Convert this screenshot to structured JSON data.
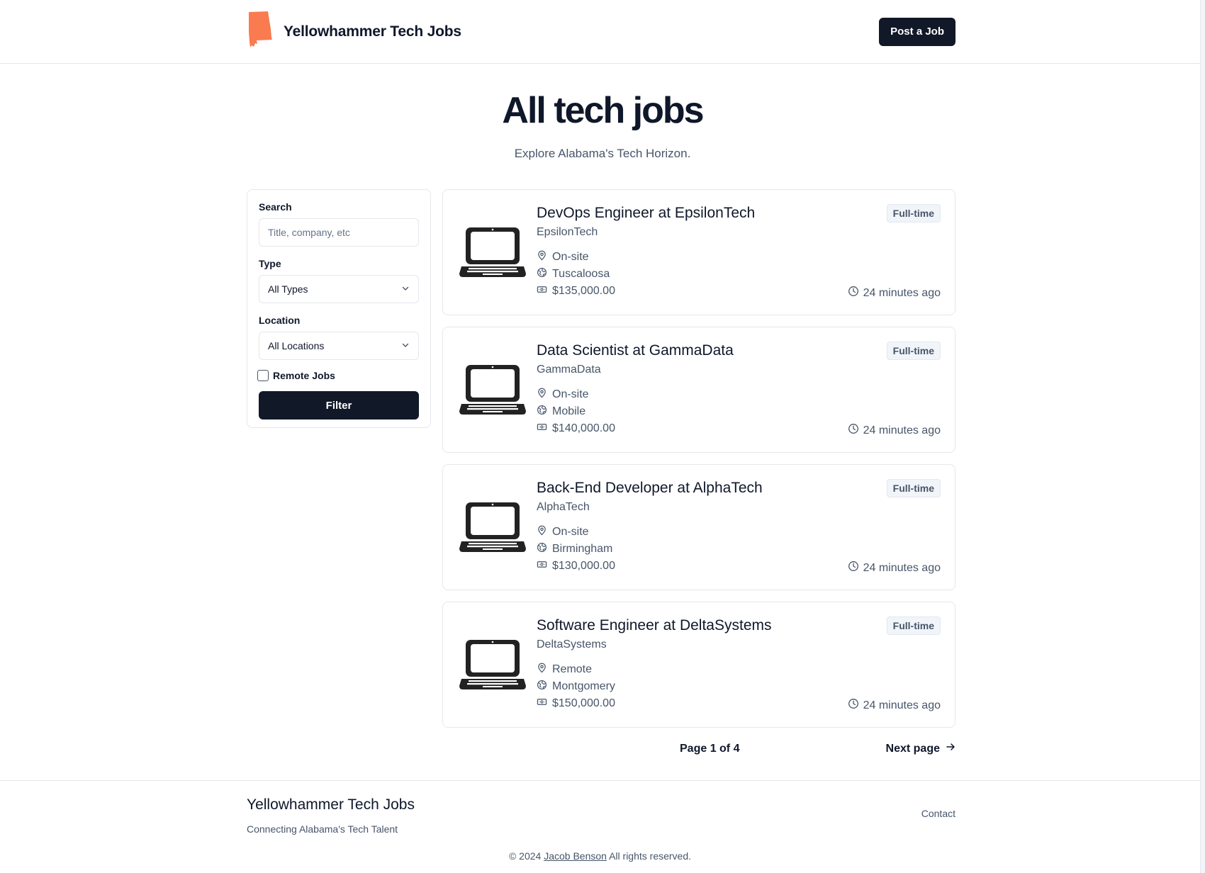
{
  "header": {
    "brand_title": "Yellowhammer Tech Jobs",
    "post_button": "Post a Job",
    "logo_color": "#f97b4f"
  },
  "hero": {
    "title": "All tech jobs",
    "subtitle": "Explore Alabama's Tech Horizon."
  },
  "filters": {
    "search_label": "Search",
    "search_placeholder": "Title, company, etc",
    "search_value": "",
    "type_label": "Type",
    "type_selected": "All Types",
    "location_label": "Location",
    "location_selected": "All Locations",
    "remote_label": "Remote Jobs",
    "remote_checked": false,
    "filter_button": "Filter"
  },
  "jobs": [
    {
      "title": "DevOps Engineer at EpsilonTech",
      "company": "EpsilonTech",
      "location_type": "On-site",
      "city": "Tuscaloosa",
      "salary": "$135,000.00",
      "badge": "Full-time",
      "posted": "24 minutes ago"
    },
    {
      "title": "Data Scientist at GammaData",
      "company": "GammaData",
      "location_type": "On-site",
      "city": "Mobile",
      "salary": "$140,000.00",
      "badge": "Full-time",
      "posted": "24 minutes ago"
    },
    {
      "title": "Back-End Developer at AlphaTech",
      "company": "AlphaTech",
      "location_type": "On-site",
      "city": "Birmingham",
      "salary": "$130,000.00",
      "badge": "Full-time",
      "posted": "24 minutes ago"
    },
    {
      "title": "Software Engineer at DeltaSystems",
      "company": "DeltaSystems",
      "location_type": "Remote",
      "city": "Montgomery",
      "salary": "$150,000.00",
      "badge": "Full-time",
      "posted": "24 minutes ago"
    }
  ],
  "pagination": {
    "page_info": "Page 1 of 4",
    "next_label": "Next page"
  },
  "footer": {
    "title": "Yellowhammer Tech Jobs",
    "tagline": "Connecting Alabama's Tech Talent",
    "contact": "Contact",
    "copyright_prefix": "© 2024",
    "author": "Jacob Benson",
    "copyright_suffix": "All rights reserved."
  },
  "icons": {
    "logo": "alabama-state-icon",
    "job_logo": "laptop-icon",
    "location": "map-pin-icon",
    "city": "globe-icon",
    "salary": "banknote-icon",
    "time": "clock-icon",
    "select": "chevron-down-icon",
    "next": "arrow-right-icon"
  }
}
